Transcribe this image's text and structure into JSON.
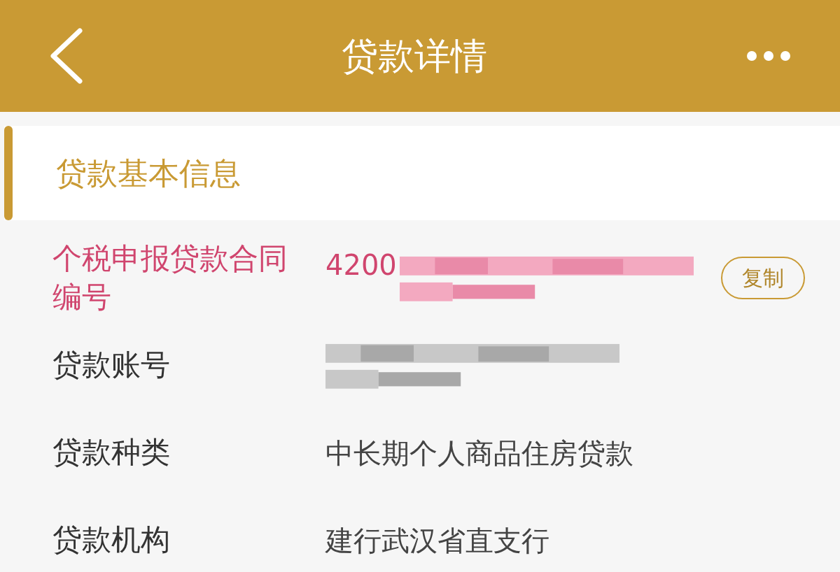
{
  "header": {
    "title": "贷款详情"
  },
  "section": {
    "title": "贷款基本信息"
  },
  "rows": [
    {
      "label": "个税申报贷款合同编号",
      "value": "4200",
      "redacted": true,
      "highlighted": true,
      "action": "复制"
    },
    {
      "label": "贷款账号",
      "redacted": true,
      "highlighted": false
    },
    {
      "label": "贷款种类",
      "value": "中长期个人商品住房贷款",
      "redacted": false,
      "highlighted": false
    },
    {
      "label": "贷款机构",
      "value": "建行武汉省直支行",
      "redacted": false,
      "highlighted": false
    }
  ]
}
